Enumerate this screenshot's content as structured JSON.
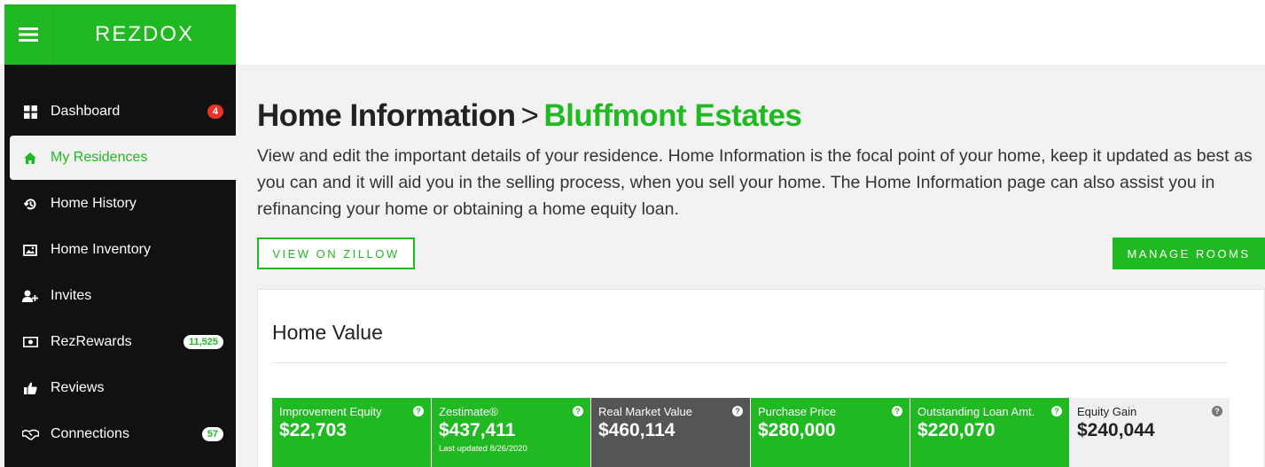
{
  "brand": {
    "logo": "REZDOX"
  },
  "sidebar": {
    "items": [
      {
        "label": "Dashboard",
        "icon": "dashboard-icon",
        "badge": "4"
      },
      {
        "label": "My Residences",
        "icon": "home-icon",
        "badge": ""
      },
      {
        "label": "Home History",
        "icon": "history-icon",
        "badge": ""
      },
      {
        "label": "Home Inventory",
        "icon": "image-icon",
        "badge": ""
      },
      {
        "label": "Invites",
        "icon": "add-user-icon",
        "badge": ""
      },
      {
        "label": "RezRewards",
        "icon": "money-icon",
        "badge": "11,525"
      },
      {
        "label": "Reviews",
        "icon": "thumbs-up-icon",
        "badge": ""
      },
      {
        "label": "Connections",
        "icon": "handshake-icon",
        "badge": "57"
      }
    ]
  },
  "main": {
    "title": "Home Information",
    "separator": ">",
    "residence": "Bluffmont Estates",
    "description": "View and edit the important details of your residence. Home Information is the focal point of your home, keep it updated as best as you can and it will aid you in the selling process, when you sell your home. The Home Information page can also assist you in refinancing your home or obtaining a home equity loan.",
    "zillow_button": "VIEW ON ZILLOW",
    "rooms_button": "MANAGE ROOMS"
  },
  "home_value": {
    "title": "Home Value",
    "tiles": [
      {
        "label": "Improvement Equity",
        "value": "$22,703",
        "sub": ""
      },
      {
        "label": "Zestimate®",
        "value": "$437,411",
        "sub": "Last updated 8/26/2020"
      },
      {
        "label": "Real Market Value",
        "value": "$460,114",
        "sub": ""
      },
      {
        "label": "Purchase Price",
        "value": "$280,000",
        "sub": ""
      },
      {
        "label": "Outstanding Loan Amt.",
        "value": "$220,070",
        "sub": ""
      },
      {
        "label": "Equity Gain",
        "value": "$240,044",
        "sub": ""
      }
    ],
    "help_glyph": "?"
  },
  "colors": {
    "brand_green": "#21b921",
    "sidebar_bg": "#111111",
    "badge_red": "#e8342a",
    "dark_tile": "#555555"
  }
}
